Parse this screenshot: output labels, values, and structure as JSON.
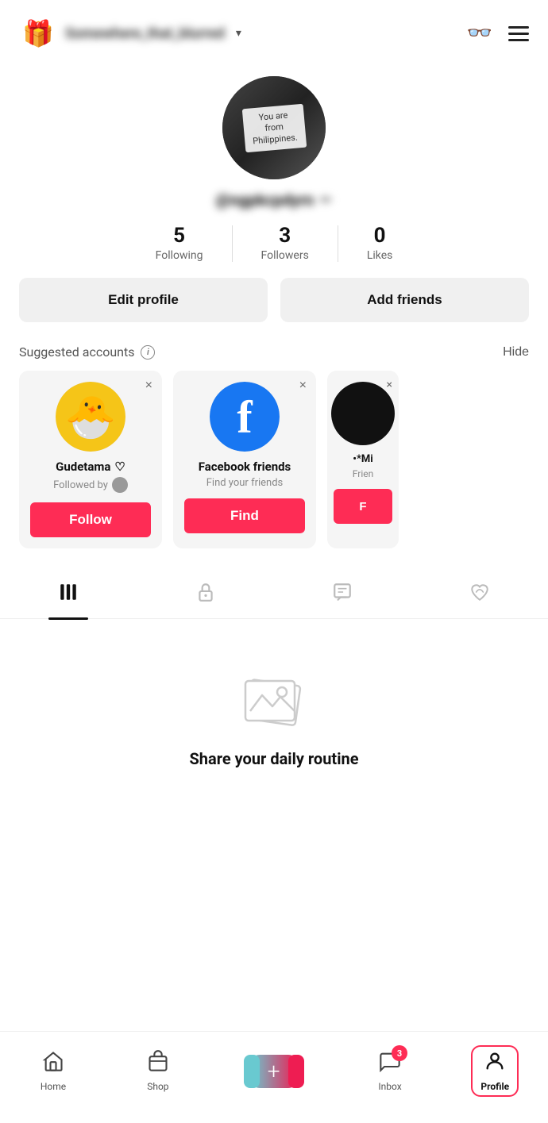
{
  "header": {
    "gift_emoji": "🎁",
    "username": "Somewhere_that_blurred",
    "chevron": "▾",
    "glasses_unicode": "👓",
    "menu_label": "menu"
  },
  "profile": {
    "avatar_note_line1": "You are",
    "avatar_note_line2": "from",
    "avatar_note_line3": "Philippines.",
    "username": "@ngpkcpdyrn",
    "verified_icon": "✏"
  },
  "stats": {
    "following_count": "5",
    "following_label": "Following",
    "followers_count": "3",
    "followers_label": "Followers",
    "likes_count": "0",
    "likes_label": "Likes"
  },
  "buttons": {
    "edit_profile": "Edit profile",
    "add_friends": "Add friends"
  },
  "suggested": {
    "title": "Suggested accounts",
    "info_i": "i",
    "hide": "Hide",
    "cards": [
      {
        "name": "Gudetama",
        "heart": "♡",
        "sub": "Followed by",
        "action": "Follow"
      },
      {
        "name": "Facebook friends",
        "sub": "Find your friends",
        "action": "Find"
      },
      {
        "name": "•*Mi",
        "sub": "Frien",
        "action": "F"
      }
    ]
  },
  "tabs": {
    "videos": "videos-icon",
    "lock": "lock-icon",
    "chat": "chat-icon",
    "heart": "heart-icon"
  },
  "empty_state": {
    "title": "Share your daily routine",
    "subtitle": ""
  },
  "bottom_nav": {
    "home_label": "Home",
    "shop_label": "Shop",
    "plus_label": "",
    "inbox_label": "Inbox",
    "inbox_badge": "3",
    "profile_label": "Profile"
  }
}
